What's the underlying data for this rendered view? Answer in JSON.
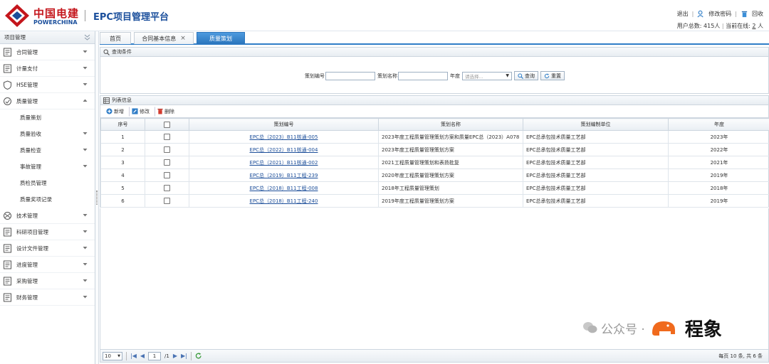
{
  "header": {
    "brand_cn": "中国电建",
    "brand_en": "POWERCHINA",
    "system_title": "EPC项目管理平台",
    "links": {
      "logout": "退出",
      "change_password": "修改密码",
      "back": "回收"
    },
    "users": {
      "total_label": "用户总数:",
      "total_value": "415人",
      "online_label": "当前在线:",
      "online_value": "2",
      "online_unit": "人"
    }
  },
  "sidebar": {
    "title": "项目管理",
    "items": [
      {
        "label": "合同管理",
        "icon": "contract-icon"
      },
      {
        "label": "计量支付",
        "icon": "payment-icon"
      },
      {
        "label": "HSE管理",
        "icon": "shield-icon"
      },
      {
        "label": "质量管理",
        "icon": "quality-icon",
        "expanded": true
      },
      {
        "label": "技术管理",
        "icon": "tech-icon"
      },
      {
        "label": "科研项目管理",
        "icon": "research-icon"
      },
      {
        "label": "设计文件管理",
        "icon": "design-icon"
      },
      {
        "label": "进度管理",
        "icon": "schedule-icon"
      },
      {
        "label": "采购管理",
        "icon": "procurement-icon"
      },
      {
        "label": "财务管理",
        "icon": "finance-icon"
      }
    ],
    "subitems": [
      {
        "label": "质量策划",
        "has_arrow": false
      },
      {
        "label": "质量验收",
        "has_arrow": true
      },
      {
        "label": "质量检查",
        "has_arrow": true
      },
      {
        "label": "事故管理",
        "has_arrow": true
      },
      {
        "label": "质检员管理",
        "has_arrow": false
      },
      {
        "label": "质量奖项记录",
        "has_arrow": false
      }
    ]
  },
  "tabs": [
    {
      "label": "首页",
      "closable": false,
      "active": false
    },
    {
      "label": "合同基本信息",
      "closable": true,
      "active": false
    },
    {
      "label": "质量策划",
      "closable": false,
      "active": true
    }
  ],
  "query": {
    "panel_title": "查询条件",
    "code_label": "策划编号",
    "code_value": "",
    "name_label": "策划名称",
    "name_value": "",
    "year_label": "年度",
    "year_placeholder": "请选择...",
    "search_button": "查询",
    "reset_button": "重置"
  },
  "list": {
    "panel_title": "列表信息",
    "toolbar": {
      "add": "新增",
      "edit": "修改",
      "delete": "删除"
    },
    "columns": [
      "序号",
      "",
      "策划编号",
      "策划名称",
      "策划编制单位",
      "年度"
    ],
    "rows": [
      {
        "no": "1",
        "code": "EPC总（2023）B11核通-005",
        "name": "2023年度工程质量管理策划方案和质量EPC总（2023）A078",
        "unit": "EPC总承包技术质量工艺部",
        "year": "2023年"
      },
      {
        "no": "2",
        "code": "EPC总（2022）B11核通-004",
        "name": "2023年度工程质量管理策划方案",
        "unit": "EPC总承包技术质量工艺部",
        "year": "2022年"
      },
      {
        "no": "3",
        "code": "EPC总（2021）B11核通-002",
        "name": "2021工程质量管理策划和表扬批复",
        "unit": "EPC总承包技术质量工艺部",
        "year": "2021年"
      },
      {
        "no": "4",
        "code": "EPC总（2019）B11工程-239",
        "name": "2020年度工程质量管理策划方案",
        "unit": "EPC总承包技术质量工艺部",
        "year": "2019年"
      },
      {
        "no": "5",
        "code": "EPC总（2018）B11工程-008",
        "name": "2018年工程质量管理策划",
        "unit": "EPC总承包技术质量工艺部",
        "year": "2018年"
      },
      {
        "no": "6",
        "code": "EPC总（2018）B11工程-240",
        "name": "2019年度工程质量管理策划方案",
        "unit": "EPC总承包技术质量工艺部",
        "year": "2019年"
      }
    ]
  },
  "pager": {
    "page_size": "10",
    "current_page": "1",
    "total_pages": "/1",
    "summary": "每页 10 条, 共 6 条"
  },
  "watermark": {
    "text": "公众号 ·",
    "brand": "程象"
  }
}
